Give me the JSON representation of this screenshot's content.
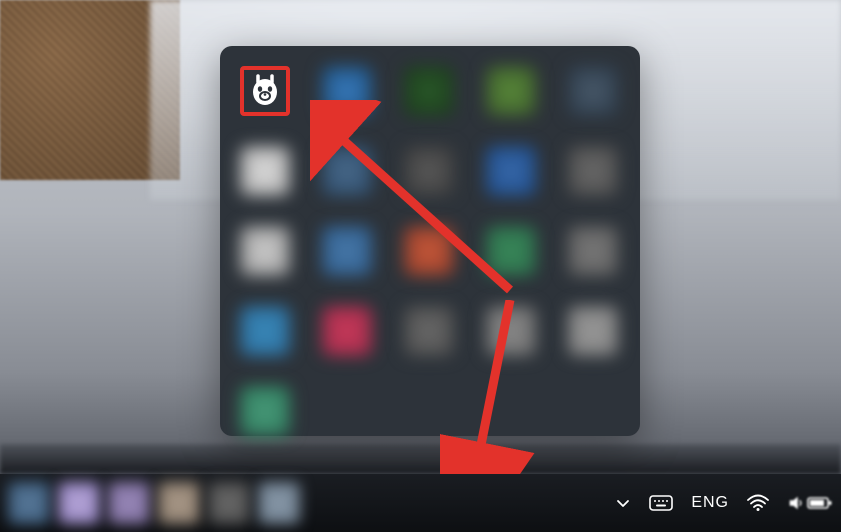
{
  "tray_popup": {
    "highlighted_icon": {
      "name": "ollama"
    },
    "icons": [
      {
        "row": 1,
        "col": 1,
        "name": "ollama",
        "highlighted": true
      },
      {
        "row": 1,
        "col": 2,
        "name": "app-blue"
      },
      {
        "row": 1,
        "col": 3,
        "name": "app-dark-green"
      },
      {
        "row": 1,
        "col": 4,
        "name": "app-green"
      },
      {
        "row": 1,
        "col": 5,
        "name": "app-gray-1"
      },
      {
        "row": 2,
        "col": 1,
        "name": "app-white"
      },
      {
        "row": 2,
        "col": 2,
        "name": "app-blue-2"
      },
      {
        "row": 2,
        "col": 3,
        "name": "app-gray-2"
      },
      {
        "row": 2,
        "col": 4,
        "name": "app-blue-3"
      },
      {
        "row": 2,
        "col": 5,
        "name": "app-gray-3"
      },
      {
        "row": 3,
        "col": 1,
        "name": "app-white-2"
      },
      {
        "row": 3,
        "col": 2,
        "name": "app-blue-4"
      },
      {
        "row": 3,
        "col": 3,
        "name": "app-orange"
      },
      {
        "row": 3,
        "col": 4,
        "name": "app-wechat"
      },
      {
        "row": 3,
        "col": 5,
        "name": "app-gray-4"
      },
      {
        "row": 4,
        "col": 1,
        "name": "app-teal"
      },
      {
        "row": 4,
        "col": 2,
        "name": "app-red"
      },
      {
        "row": 4,
        "col": 3,
        "name": "app-gray-5"
      },
      {
        "row": 4,
        "col": 4,
        "name": "app-gray-6"
      },
      {
        "row": 4,
        "col": 5,
        "name": "app-gray-7"
      },
      {
        "row": 5,
        "col": 1,
        "name": "app-teal-2"
      }
    ]
  },
  "taskbar": {
    "language": "ENG",
    "pinned_count": 6
  },
  "annotations": {
    "highlight_color": "#e3322b",
    "arrow_color": "#e3322b"
  }
}
